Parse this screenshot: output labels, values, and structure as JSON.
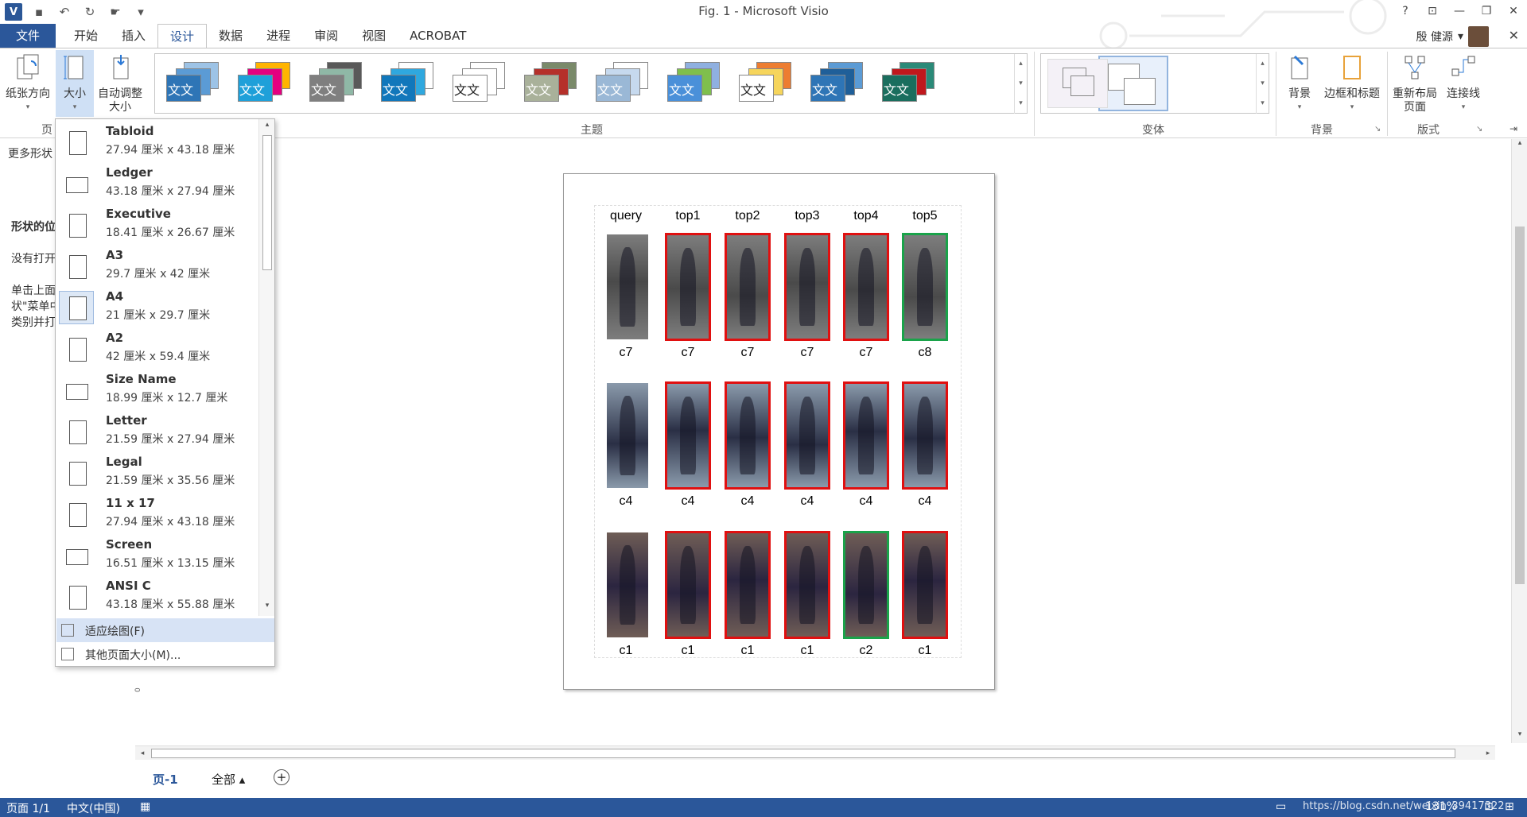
{
  "window": {
    "title": "Fig. 1 - Microsoft Visio",
    "controls": [
      "?",
      "⊡",
      "—",
      "❐",
      "✕"
    ]
  },
  "qat": {
    "logo": "V",
    "save": "💾",
    "undo": "↶",
    "redo": "↻",
    "touch": "✋"
  },
  "tabs": {
    "file": "文件",
    "items": [
      "开始",
      "插入",
      "设计",
      "数据",
      "进程",
      "审阅",
      "视图",
      "ACROBAT"
    ],
    "active": "设计"
  },
  "user": {
    "name": "殷 健源"
  },
  "ribbon": {
    "page_setup": {
      "orientation": "纸张方向",
      "size": "大小",
      "auto_size_1": "自动调整",
      "auto_size_2": "大小",
      "group_label": "页"
    },
    "themes_label": "主题",
    "theme_text": "文文",
    "variants_label": "变体",
    "background": {
      "background": "背景",
      "borders": "边框和标题",
      "group_label": "背景"
    },
    "layout": {
      "relayout_1": "重新布局",
      "relayout_2": "页面",
      "connectors": "连接线",
      "group_label": "版式"
    }
  },
  "left_panel": {
    "more_shapes": "更多形状",
    "title": "形状的位",
    "line1": "没有打开",
    "line2": "单击上面",
    "line3": "状\"菜单中",
    "line4": "类别并打"
  },
  "size_dropdown": {
    "items": [
      {
        "name": "Tabloid",
        "size": "27.94 厘米 x 43.18 厘米",
        "icon": "portrait"
      },
      {
        "name": "Ledger",
        "size": "43.18 厘米 x 27.94 厘米",
        "icon": "landscape"
      },
      {
        "name": "Executive",
        "size": "18.41 厘米 x 26.67 厘米",
        "icon": "portrait"
      },
      {
        "name": "A3",
        "size": "29.7 厘米 x 42 厘米",
        "icon": "portrait"
      },
      {
        "name": "A4",
        "size": "21 厘米 x 29.7 厘米",
        "icon": "portrait"
      },
      {
        "name": "A2",
        "size": "42 厘米 x 59.4 厘米",
        "icon": "portrait"
      },
      {
        "name": "Size Name",
        "size": "18.99 厘米 x 12.7 厘米",
        "icon": "landscape"
      },
      {
        "name": "Letter",
        "size": "21.59 厘米 x 27.94 厘米",
        "icon": "portrait"
      },
      {
        "name": "Legal",
        "size": "21.59 厘米 x 35.56 厘米",
        "icon": "portrait"
      },
      {
        "name": "11 x 17",
        "size": "27.94 厘米 x 43.18 厘米",
        "icon": "portrait"
      },
      {
        "name": "Screen",
        "size": "16.51 厘米 x 13.15 厘米",
        "icon": "landscape"
      },
      {
        "name": "ANSI C",
        "size": "43.18 厘米 x 55.88 厘米",
        "icon": "portrait"
      }
    ],
    "selected": "A4",
    "fit_to_drawing": "适应绘图(F)",
    "more_sizes": "其他页面大小(M)..."
  },
  "figure": {
    "headers": [
      "query",
      "top1",
      "top2",
      "top3",
      "top4",
      "top5"
    ],
    "rows": [
      {
        "cams": [
          "c7",
          "c7",
          "c7",
          "c7",
          "c7",
          "c8"
        ],
        "match": [
          "query",
          "red",
          "red",
          "red",
          "red",
          "green"
        ],
        "palette": [
          "#7d7d7d",
          "#4a4a4a"
        ]
      },
      {
        "cams": [
          "c4",
          "c4",
          "c4",
          "c4",
          "c4",
          "c4"
        ],
        "match": [
          "query",
          "red",
          "red",
          "red",
          "red",
          "red"
        ],
        "palette": [
          "#8a9aab",
          "#2a2f45"
        ]
      },
      {
        "cams": [
          "c1",
          "c1",
          "c1",
          "c1",
          "c2",
          "c1"
        ],
        "match": [
          "query",
          "red",
          "red",
          "red",
          "green",
          "red"
        ],
        "palette": [
          "#6f5d56",
          "#2b2540"
        ]
      }
    ]
  },
  "page_tabs": {
    "page": "页-1",
    "all": "全部",
    "add": "+"
  },
  "status": {
    "page": "页面 1/1",
    "lang": "中文(中国)",
    "zoom": "131%",
    "watermark": "https://blog.csdn.net/weixin_39417322"
  }
}
